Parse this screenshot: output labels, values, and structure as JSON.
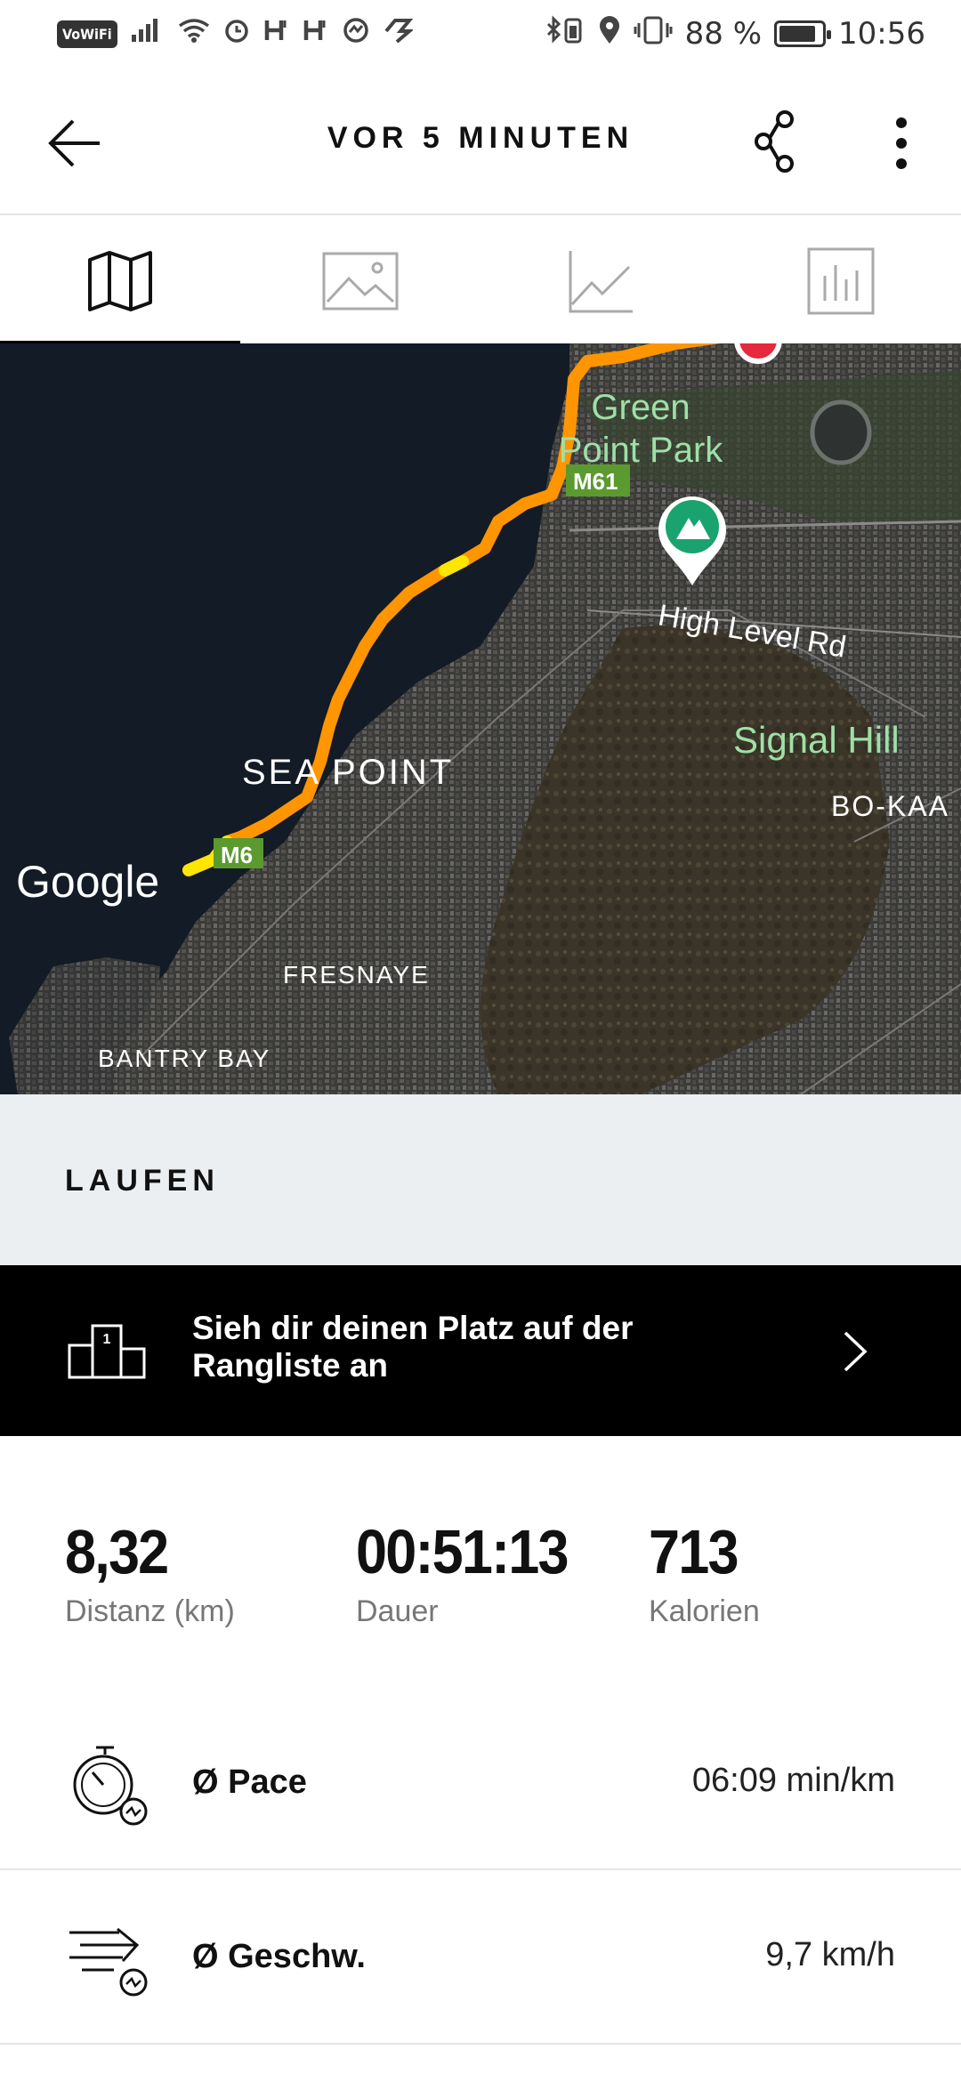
{
  "status_bar": {
    "vowifi": "VoWiFi",
    "battery_text": "88 %",
    "battery_level": 0.88,
    "time": "10:56"
  },
  "app_bar": {
    "title": "VOR 5 MINUTEN"
  },
  "tabs": [
    {
      "icon": "map-icon",
      "active": true
    },
    {
      "icon": "image-icon",
      "active": false
    },
    {
      "icon": "line-chart-icon",
      "active": false
    },
    {
      "icon": "bar-chart-icon",
      "active": false
    }
  ],
  "map": {
    "labels": {
      "green_point_park_1": "Green",
      "green_point_park_2": "Point Park",
      "m61": "M61",
      "high_level_rd": "High Level Rd",
      "signal_hill": "Signal Hill",
      "bo_kaap": "BO-KAA",
      "sea_point": "SEA POINT",
      "m6": "M6",
      "google": "Google",
      "fresnaye": "FRESNAYE",
      "bantry_bay": "BANTRY BAY"
    },
    "route_color": "#ff9500"
  },
  "activity": {
    "type": "LAUFEN"
  },
  "leaderboard": {
    "text": "Sieh dir deinen Platz auf der Rangliste an",
    "rank_badge": "1"
  },
  "stats": {
    "distance": {
      "value": "8,32",
      "label": "Distanz (km)"
    },
    "duration": {
      "value": "00:51:13",
      "label": "Dauer"
    },
    "calories": {
      "value": "713",
      "label": "Kalorien"
    }
  },
  "metrics": [
    {
      "icon": "stopwatch-pace-icon",
      "label": "Ø Pace",
      "value": "06:09 min/km"
    },
    {
      "icon": "speed-lines-icon",
      "label": "Ø Geschw.",
      "value": "9,7 km/h"
    }
  ]
}
